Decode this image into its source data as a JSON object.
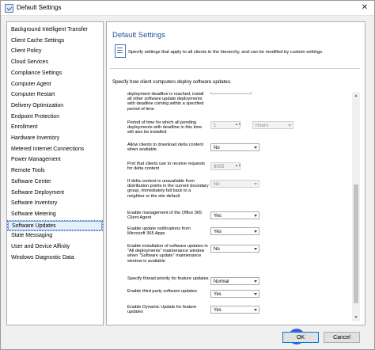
{
  "window": {
    "title": "Default Settings"
  },
  "sidebar": {
    "items": [
      "Background Intelligent Transfer",
      "Client Cache Settings",
      "Client Policy",
      "Cloud Services",
      "Compliance Settings",
      "Computer Agent",
      "Computer Restart",
      "Delivery Optimization",
      "Endpoint Protection",
      "Enrollment",
      "Hardware Inventory",
      "Metered Internet Connections",
      "Power Management",
      "Remote Tools",
      "Software Center",
      "Software Deployment",
      "Software Inventory",
      "Software Metering",
      "Software Updates",
      "State Messaging",
      "User and Device Affinity",
      "Windows Diagnostic Data"
    ],
    "selected": "Software Updates"
  },
  "main": {
    "title": "Default Settings",
    "description": "Specify settings that apply to all clients in the hierarchy, and can be modified by custom settings.",
    "subheading": "Specify how client computers deploy software updates."
  },
  "settings": [
    {
      "label": "deployment deadline is reached, install all other software update deployments with deadline coming within a specified period of time",
      "control": "stub"
    },
    {
      "label": "Period of time for which all pending deployments with deadline in this time will also be installed",
      "control": "number+unit",
      "value": "1",
      "unit": "Hours",
      "disabled": true
    },
    {
      "label": "Allow clients to download delta content when available",
      "control": "select",
      "value": "No"
    },
    {
      "label": "Port that clients use to receive requests for delta content",
      "control": "number",
      "value": "8005",
      "disabled": true
    },
    {
      "label": "If delta content is unavailable from distribution points in the current boundary group, immediately fall back to a neighbor or the site default",
      "control": "select",
      "value": "No",
      "disabled": true
    },
    {
      "label": "Enable management of the Office 365 Client Agent",
      "control": "select",
      "value": "Yes"
    },
    {
      "label": "Enable update notifications from Microsoft 365 Apps",
      "control": "select",
      "value": "Yes"
    },
    {
      "label": "Enable installation of software updates in \"All deployments\" maintenance window when \"Software update\" maintenance window is available",
      "control": "select",
      "value": "No"
    },
    {
      "label": "Specify thread priority for feature updates",
      "control": "select",
      "value": "Normal"
    },
    {
      "label": "Enable third party software updates",
      "control": "select",
      "value": "Yes"
    },
    {
      "label": "Enable Dynamic Update for feature updates",
      "control": "select",
      "value": "Yes"
    }
  ],
  "buttons": {
    "ok": "OK",
    "cancel": "Cancel"
  },
  "logo_letter": "P"
}
